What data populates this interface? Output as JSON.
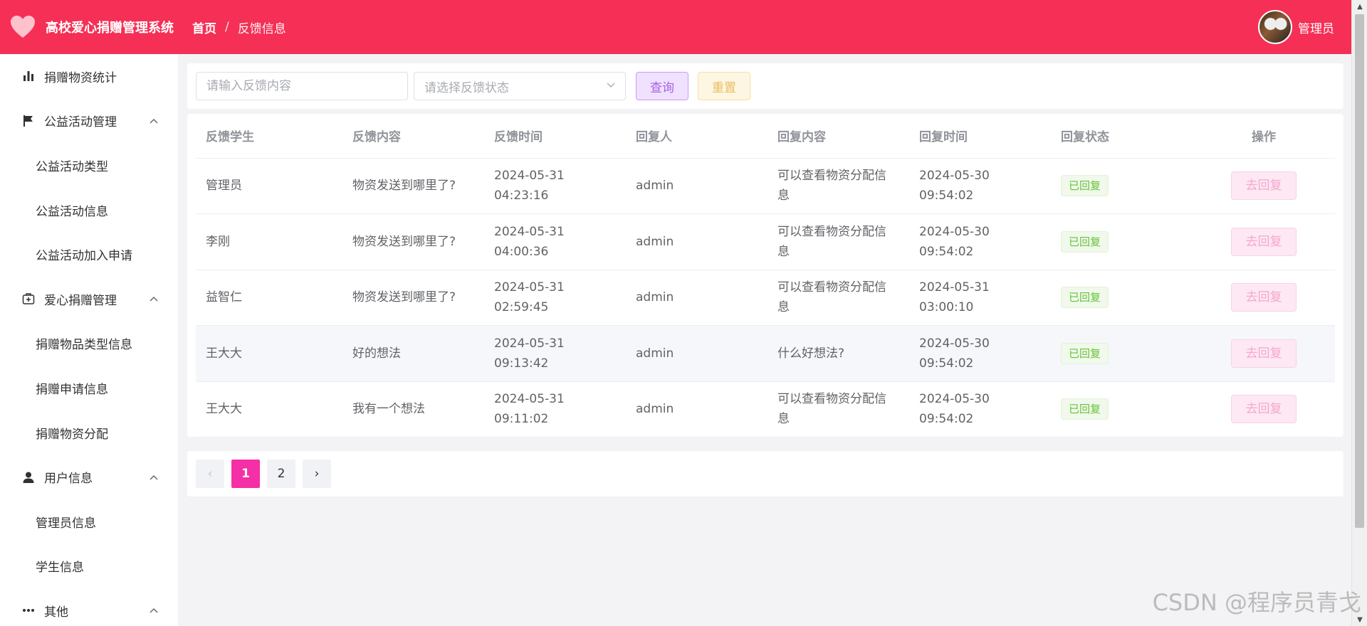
{
  "header": {
    "app_title": "高校爱心捐赠管理系统",
    "breadcrumb": {
      "home": "首页",
      "separator": "/",
      "current": "反馈信息"
    },
    "user_name": "管理员",
    "brand_color": "#f52f55"
  },
  "sidebar": {
    "items": [
      {
        "label": "捐赠物资统计",
        "icon": "bar-chart-icon",
        "level": 1
      },
      {
        "label": "公益活动管理",
        "icon": "flag-icon",
        "level": 1,
        "expanded": true
      },
      {
        "label": "公益活动类型",
        "level": 2
      },
      {
        "label": "公益活动信息",
        "level": 2
      },
      {
        "label": "公益活动加入申请",
        "level": 2
      },
      {
        "label": "爱心捐赠管理",
        "icon": "first-aid-kit-icon",
        "level": 1,
        "expanded": true
      },
      {
        "label": "捐赠物品类型信息",
        "level": 2
      },
      {
        "label": "捐赠申请信息",
        "level": 2
      },
      {
        "label": "捐赠物资分配",
        "level": 2
      },
      {
        "label": "用户信息",
        "icon": "user-icon",
        "level": 1,
        "expanded": true
      },
      {
        "label": "管理员信息",
        "level": 2
      },
      {
        "label": "学生信息",
        "level": 2
      },
      {
        "label": "其他",
        "icon": "more-dots-icon",
        "level": 1,
        "expanded": true
      }
    ]
  },
  "search": {
    "content_placeholder": "请输入反馈内容",
    "status_placeholder": "请选择反馈状态",
    "query_label": "查询",
    "reset_label": "重置"
  },
  "table": {
    "columns": [
      "反馈学生",
      "反馈内容",
      "反馈时间",
      "回复人",
      "回复内容",
      "回复时间",
      "回复状态",
      "操作"
    ],
    "rows": [
      {
        "student": "管理员",
        "content": "物资发送到哪里了?",
        "time": "2024-05-31 04:23:16",
        "replier": "admin",
        "reply": "可以查看物资分配信息",
        "reply_time": "2024-05-30 09:54:02",
        "status": "已回复",
        "action": "去回复"
      },
      {
        "student": "李刚",
        "content": "物资发送到哪里了?",
        "time": "2024-05-31 04:00:36",
        "replier": "admin",
        "reply": "可以查看物资分配信息",
        "reply_time": "2024-05-30 09:54:02",
        "status": "已回复",
        "action": "去回复"
      },
      {
        "student": "益智仁",
        "content": "物资发送到哪里了?",
        "time": "2024-05-31 02:59:45",
        "replier": "admin",
        "reply": "可以查看物资分配信息",
        "reply_time": "2024-05-31 03:00:10",
        "status": "已回复",
        "action": "去回复"
      },
      {
        "student": "王大大",
        "content": "好的想法",
        "time": "2024-05-31 09:13:42",
        "replier": "admin",
        "reply": "什么好想法?",
        "reply_time": "2024-05-30 09:54:02",
        "status": "已回复",
        "action": "去回复"
      },
      {
        "student": "王大大",
        "content": "我有一个想法",
        "time": "2024-05-31 09:11:02",
        "replier": "admin",
        "reply": "可以查看物资分配信息",
        "reply_time": "2024-05-30 09:54:02",
        "status": "已回复",
        "action": "去回复"
      }
    ]
  },
  "pagination": {
    "prev_icon": "‹",
    "next_icon": "›",
    "pages": [
      "1",
      "2"
    ],
    "current": "1",
    "active_color": "#f52fa5"
  },
  "watermark": "CSDN @程序员青戈"
}
